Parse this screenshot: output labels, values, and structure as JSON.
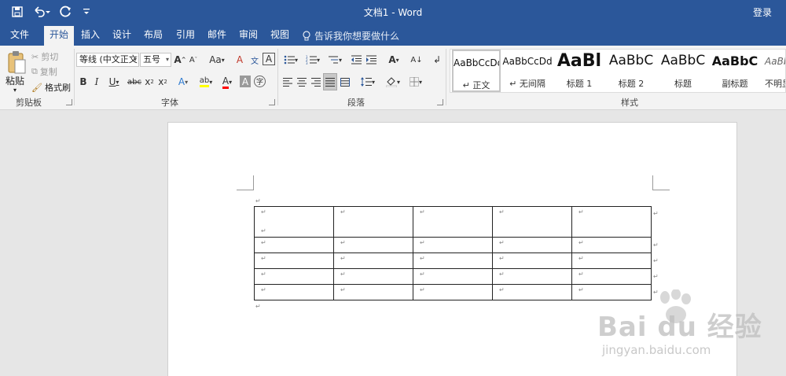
{
  "window": {
    "title": "文档1  -  Word",
    "login": "登录"
  },
  "quick_access": {
    "save_icon": "save-icon",
    "undo_icon": "undo-icon",
    "redo_icon": "redo-icon",
    "customize_icon": "customize-icon"
  },
  "tabs": [
    "文件",
    "开始",
    "插入",
    "设计",
    "布局",
    "引用",
    "邮件",
    "审阅",
    "视图"
  ],
  "active_tab": "开始",
  "tell_me": "告诉我你想要做什么",
  "clipboard": {
    "paste": "粘贴",
    "cut": "剪切",
    "copy": "复制",
    "format_painter": "格式刷",
    "group_label": "剪贴板"
  },
  "font": {
    "font_name": "等线 (中文正文)",
    "font_size": "五号",
    "group_label": "字体"
  },
  "paragraph": {
    "group_label": "段落"
  },
  "styles": {
    "group_label": "样式",
    "items": [
      {
        "sample": "AaBbCcDd",
        "name": "↵ 正文"
      },
      {
        "sample": "AaBbCcDd",
        "name": "↵ 无间隔"
      },
      {
        "sample": "AaBl",
        "name": "标题 1"
      },
      {
        "sample": "AaBbC",
        "name": "标题 2"
      },
      {
        "sample": "AaBbC",
        "name": "标题"
      },
      {
        "sample": "AaBbC",
        "name": "副标题"
      },
      {
        "sample": "AaBb",
        "name": "不明显"
      }
    ]
  },
  "document": {
    "paragraph_mark": "↵",
    "table": {
      "rows": 5,
      "cols": 5,
      "cell_text": [
        "↵",
        "↵"
      ]
    }
  },
  "watermark": {
    "brand": "Bai du 经验",
    "url": "jingyan.baidu.com"
  },
  "colors": {
    "titlebar": "#2b579a",
    "ribbon": "#f3f3f3",
    "highlight": "#ffff00",
    "font_color": "#ff0000"
  }
}
